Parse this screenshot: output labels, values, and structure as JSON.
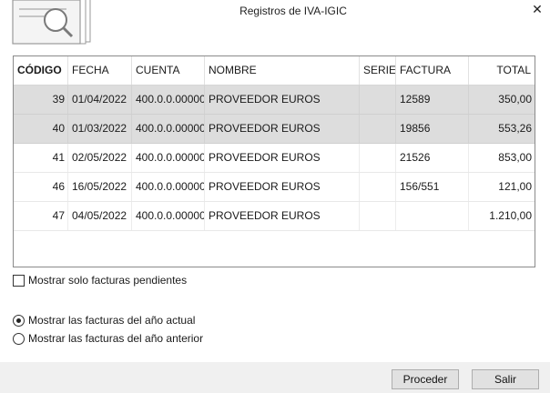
{
  "window": {
    "title": "Registros de IVA-IGIC",
    "close_icon": "close-icon"
  },
  "grid": {
    "headers": {
      "codigo": "CÓDIGO",
      "fecha": "FECHA",
      "cuenta": "CUENTA",
      "nombre": "NOMBRE",
      "serie": "SERIE",
      "factura": "FACTURA",
      "total": "TOTAL"
    },
    "rows": [
      {
        "codigo": "39",
        "fecha": "01/04/2022",
        "cuenta": "400.0.0.00000",
        "nombre": "PROVEEDOR EUROS",
        "serie": "",
        "factura": "12589",
        "total": "350,00"
      },
      {
        "codigo": "40",
        "fecha": "01/03/2022",
        "cuenta": "400.0.0.00000",
        "nombre": "PROVEEDOR EUROS",
        "serie": "",
        "factura": "19856",
        "total": "553,26"
      },
      {
        "codigo": "41",
        "fecha": "02/05/2022",
        "cuenta": "400.0.0.00000",
        "nombre": "PROVEEDOR EUROS",
        "serie": "",
        "factura": "21526",
        "total": "853,00"
      },
      {
        "codigo": "46",
        "fecha": "16/05/2022",
        "cuenta": "400.0.0.00000",
        "nombre": "PROVEEDOR EUROS",
        "serie": "",
        "factura": "156/551",
        "total": "121,00"
      },
      {
        "codigo": "47",
        "fecha": "04/05/2022",
        "cuenta": "400.0.0.00000",
        "nombre": "PROVEEDOR EUROS",
        "serie": "",
        "factura": "",
        "total": "1.210,00"
      }
    ],
    "selected_rows": [
      0,
      1
    ]
  },
  "options": {
    "pending_only_label": "Mostrar solo facturas pendientes",
    "pending_only_checked": false,
    "current_year_label": "Mostrar las facturas del año actual",
    "previous_year_label": "Mostrar las facturas del año anterior",
    "selected_year": "current"
  },
  "footer": {
    "proceed_label": "Proceder",
    "exit_label": "Salir"
  },
  "colors": {
    "selected_row": "#dddddd",
    "footer_bg": "#f0f0f0"
  }
}
